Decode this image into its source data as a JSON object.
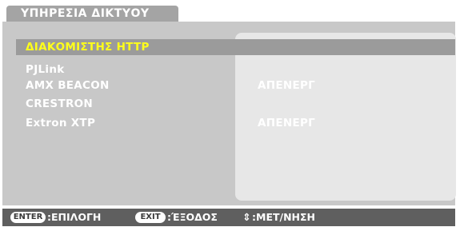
{
  "title": "ΥΠΗΡΕΣΙΑ ΔΙΚΤΥΟΥ",
  "menu": {
    "items": [
      {
        "label": "ΔΙΑΚΟΜΙΣΤΗΣ HTTP",
        "value": "",
        "selected": true
      },
      {
        "label": "PJLink",
        "value": "",
        "selected": false
      },
      {
        "label": "AMX BEACON",
        "value": "ΑΠΕΝΕΡΓ",
        "selected": false
      },
      {
        "label": "CRESTRON",
        "value": "",
        "selected": false
      },
      {
        "label": "Extron XTP",
        "value": "ΑΠΕΝΕΡΓ",
        "selected": false
      }
    ]
  },
  "footer": {
    "enter_key": "ENTER",
    "enter_action": ":ΕΠΙΛΟΓΗ",
    "exit_key": "EXIT",
    "exit_action": ":ΈΞΟΔΟΣ",
    "nav_icon": "⇕",
    "nav_action": ":ΜΕΤ/ΝΗΣΗ"
  },
  "colors": {
    "selected_text": "#ffff1a",
    "selected_row": "#9b9b9b",
    "panel": "#c8c8c8",
    "footer": "#5f5f5f"
  }
}
